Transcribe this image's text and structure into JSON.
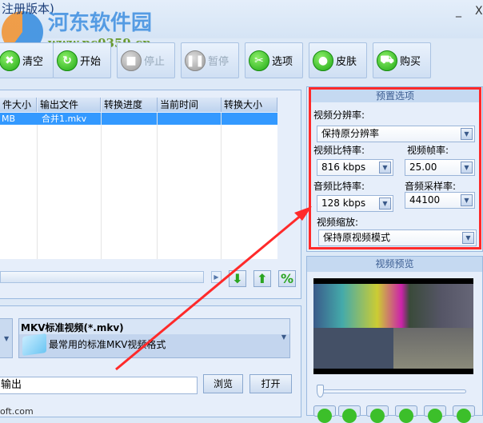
{
  "window": {
    "title": "注册版本)",
    "minimize": "_",
    "close": "X"
  },
  "watermark": {
    "name": "河东软件园",
    "url": "www.pc0359.cn"
  },
  "toolbar": [
    {
      "label": "清空",
      "icon": "clear-icon",
      "glyph": "✖",
      "enabled": true
    },
    {
      "label": "开始",
      "icon": "start-icon",
      "glyph": "↻",
      "enabled": true
    },
    {
      "label": "停止",
      "icon": "stop-icon",
      "glyph": "■",
      "enabled": false
    },
    {
      "label": "暂停",
      "icon": "pause-icon",
      "glyph": "❚❚",
      "enabled": false
    },
    {
      "label": "选项",
      "icon": "options-icon",
      "glyph": "✂",
      "enabled": true
    },
    {
      "label": "皮肤",
      "icon": "skin-icon",
      "glyph": "●",
      "enabled": true
    },
    {
      "label": "购买",
      "icon": "cart-icon",
      "glyph": "⛟",
      "enabled": true
    }
  ],
  "table": {
    "headers": [
      "件大小",
      "输出文件",
      "转换进度",
      "当前时间",
      "转换大小"
    ],
    "rows": [
      [
        "MB",
        "合并1.mkv",
        "",
        "",
        ""
      ]
    ]
  },
  "presets": {
    "title": "预置选项",
    "resolution_label": "视频分辨率:",
    "resolution": "保持原分辨率",
    "vbitrate_label": "视频比特率:",
    "vbitrate": "816 kbps",
    "fps_label": "视频帧率:",
    "fps": "25.00",
    "abitrate_label": "音频比特率:",
    "abitrate": "128 kbps",
    "samplerate_label": "音频采样率:",
    "samplerate": "44100",
    "scale_label": "视频缩放:",
    "scale": "保持原视频模式"
  },
  "preview": {
    "title": "视频预览"
  },
  "format": {
    "name": "MKV标准视频(*.mkv)",
    "desc": "最常用的标准MKV视频格式"
  },
  "output": {
    "path": "输出",
    "browse": "浏览",
    "open": "打开"
  },
  "footer": {
    "site": "oft.com"
  },
  "colors": {
    "accent": "#3399ff",
    "highlight": "#ff2a2a"
  }
}
